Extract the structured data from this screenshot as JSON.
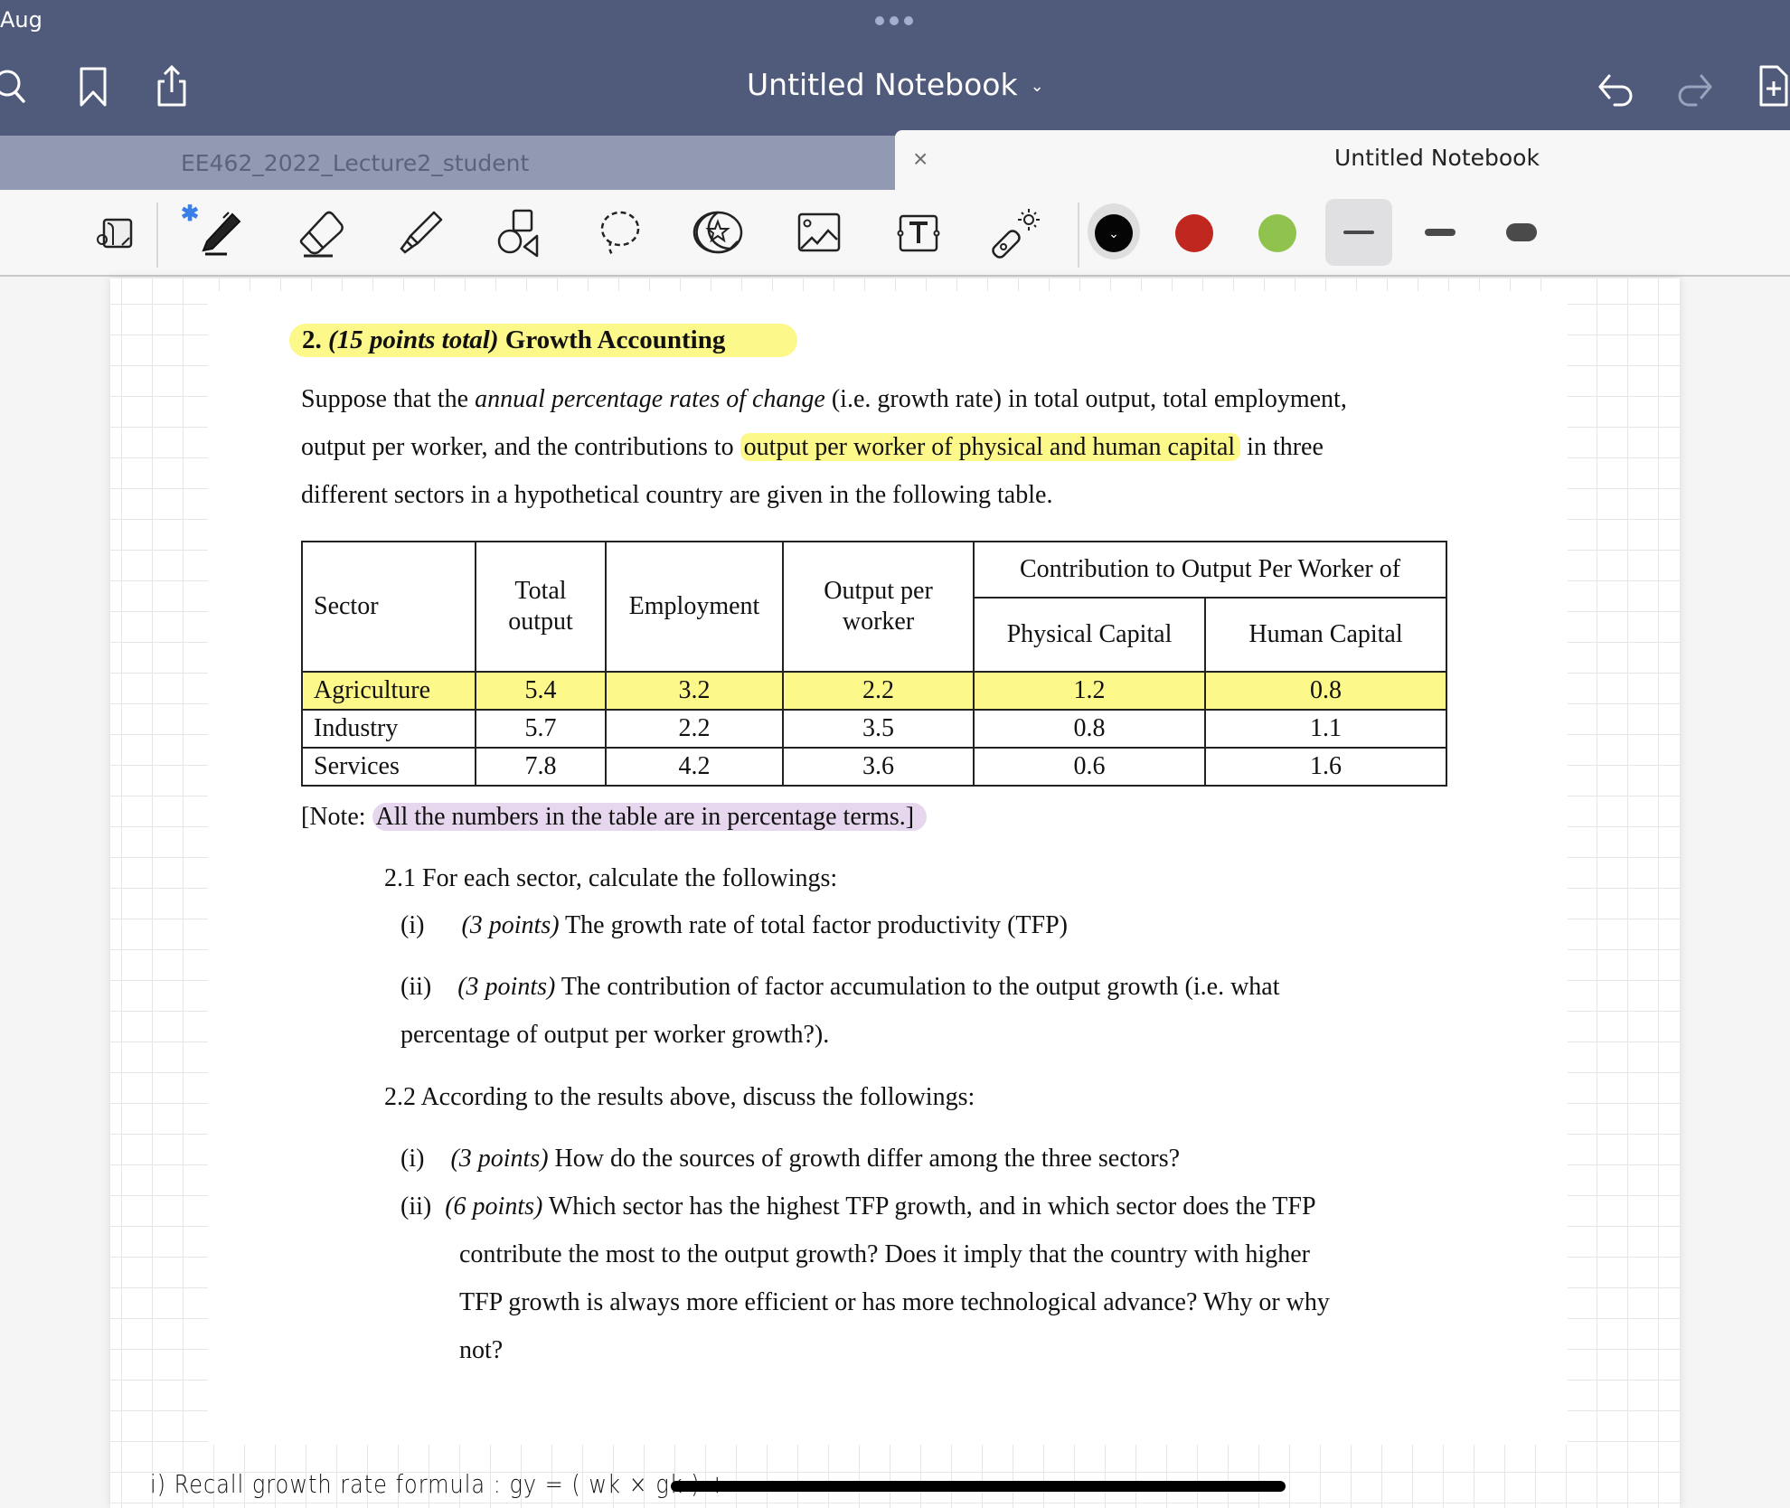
{
  "status_bar": {
    "date": "Aug"
  },
  "nav": {
    "title": "Untitled Notebook",
    "icons": [
      "search-icon",
      "bookmark-icon",
      "share-icon",
      "undo-icon",
      "redo-icon",
      "add-page-icon"
    ]
  },
  "tabs": [
    {
      "label": "EE462_2022_Lecture2_student",
      "active": false
    },
    {
      "label": "Untitled Notebook",
      "active": true,
      "close_glyph": "×"
    }
  ],
  "toolbar": {
    "tools": [
      "read-only-toggle",
      "pen",
      "eraser",
      "highlighter",
      "shapes",
      "lasso",
      "elements",
      "image",
      "text",
      "laser-pointer"
    ],
    "bluetooth_glyph": "✱",
    "colors": [
      {
        "name": "black",
        "hex": "#050505",
        "selected": true
      },
      {
        "name": "red",
        "hex": "#c0281f",
        "selected": false
      },
      {
        "name": "green",
        "hex": "#8fc34d",
        "selected": false
      }
    ],
    "stroke_widths": [
      "thin",
      "medium",
      "thick"
    ],
    "selected_width": "thin"
  },
  "document": {
    "heading": {
      "number": "2.",
      "points": "(15 points total)",
      "title": "Growth Accounting"
    },
    "intro": {
      "line1_a": "Suppose that the ",
      "line1_italic": "annual percentage rates of change",
      "line1_b": " (i.e. growth rate) in total output, total employment,",
      "line2_a": "output per worker, and the contributions to ",
      "line2_highlight": "output per worker of physical and human capital",
      "line2_b": " in three",
      "line3": "different sectors in a hypothetical country are given in the following table."
    },
    "table": {
      "headers": {
        "sector": "Sector",
        "total_output": "Total output",
        "employment": "Employment",
        "output_per_worker": "Output per worker",
        "contribution_group": "Contribution to Output Per Worker of",
        "physical_capital": "Physical Capital",
        "human_capital": "Human Capital"
      },
      "rows": [
        {
          "sector": "Agriculture",
          "total_output": "5.4",
          "employment": "3.2",
          "output_per_worker": "2.2",
          "physical_capital": "1.2",
          "human_capital": "0.8"
        },
        {
          "sector": "Industry",
          "total_output": "5.7",
          "employment": "2.2",
          "output_per_worker": "3.5",
          "physical_capital": "0.8",
          "human_capital": "1.1"
        },
        {
          "sector": "Services",
          "total_output": "7.8",
          "employment": "4.2",
          "output_per_worker": "3.6",
          "physical_capital": "0.6",
          "human_capital": "1.6"
        }
      ]
    },
    "note": {
      "prefix": "[Note: ",
      "highlight": "All the numbers in the table are in percentage terms.]"
    },
    "q2_1": {
      "title": "2.1 For each sector, calculate the followings:",
      "i_num": "(i)",
      "i_points": "(3 points)",
      "i_text": "The growth rate of total factor productivity (TFP)",
      "ii_num": "(ii)",
      "ii_points": "(3 points)",
      "ii_text": "The contribution of factor accumulation to the output growth (i.e. what",
      "ii_text2": "percentage of output per worker growth?)."
    },
    "q2_2": {
      "title": "2.2 According to the results above, discuss the followings:",
      "i_num": "(i)",
      "i_points": "(3 points)",
      "i_text": "How do the sources of growth differ among the three sectors?",
      "ii_num": "(ii)",
      "ii_points": "(6 points)",
      "ii_text": "Which sector has the highest TFP growth, and in which sector does the TFP",
      "ii_text2": "contribute the most to the output growth?  Does it imply that the country with higher",
      "ii_text3": "TFP growth is always more efficient or has more technological advance? Why or why",
      "ii_text4": "not?"
    }
  },
  "handwritten_note": "i) Recall  growth rate  formula :  gy = ( wk × gk ) +"
}
